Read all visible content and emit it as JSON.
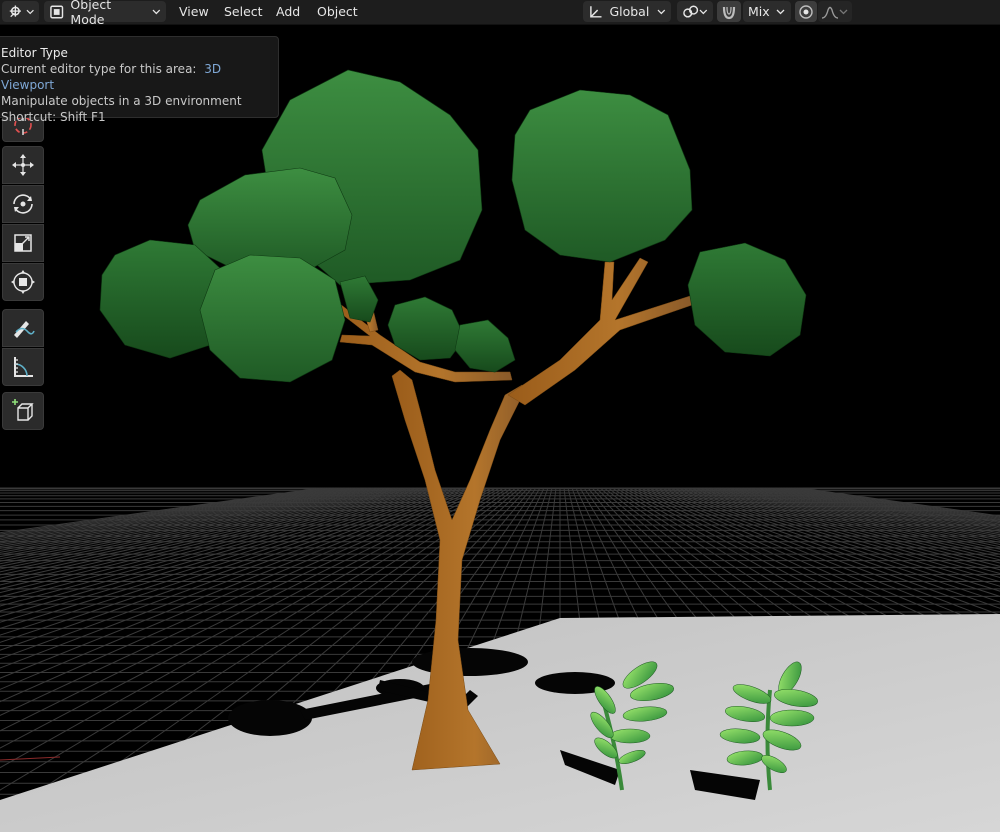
{
  "header": {
    "mode": "Object Mode",
    "menus": [
      "View",
      "Select",
      "Add",
      "Object"
    ],
    "orientation": "Global",
    "snap_mode": "Mix"
  },
  "tooltip": {
    "title": "Editor Type",
    "line_prefix": "Current editor type for this area:",
    "line_value": "3D Viewport",
    "description": "Manipulate objects in a 3D environment",
    "shortcut": "Shortcut: Shift F1"
  },
  "tools": [
    "cursor-icon",
    "move-icon",
    "rotate-icon",
    "scale-icon",
    "transform-icon",
    "annotate-icon",
    "measure-icon",
    "add-cube-icon"
  ],
  "colors": {
    "header_bg": "#1d1d1d",
    "viewport_bg": "#000000",
    "foliage": "#2f7a35",
    "trunk": "#a8661f",
    "ground": "#c9c9c9",
    "accent": "#7fa8d6"
  }
}
